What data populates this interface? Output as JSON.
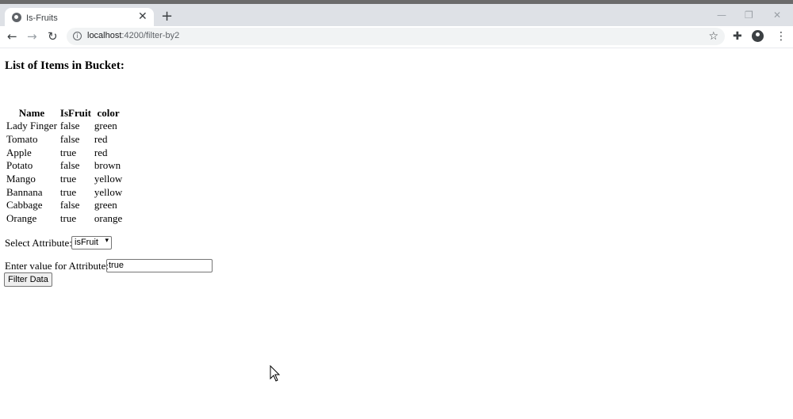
{
  "browser": {
    "tab_title": "Is-Fruits",
    "tab_close": "✕",
    "new_tab": "+",
    "url_host": "localhost",
    "url_path": ":4200/filter-by2",
    "window_controls": {
      "minimize": "—",
      "restore": "❐",
      "close": "✕"
    }
  },
  "page": {
    "heading": "List of Items in Bucket:",
    "table": {
      "headers": [
        "Name",
        "IsFruit",
        "color"
      ],
      "rows": [
        [
          "Lady Finger",
          "false",
          "green"
        ],
        [
          "Tomato",
          "false",
          "red"
        ],
        [
          "Apple",
          "true",
          "red"
        ],
        [
          "Potato",
          "false",
          "brown"
        ],
        [
          "Mango",
          "true",
          "yellow"
        ],
        [
          "Bannana",
          "true",
          "yellow"
        ],
        [
          "Cabbage",
          "false",
          "green"
        ],
        [
          "Orange",
          "true",
          "orange"
        ]
      ]
    },
    "select_label": "Select Attribute:",
    "select_value": "isFruit",
    "value_label": "Enter value for Attribute:",
    "value_input": "true",
    "filter_button": "Filter Data"
  }
}
